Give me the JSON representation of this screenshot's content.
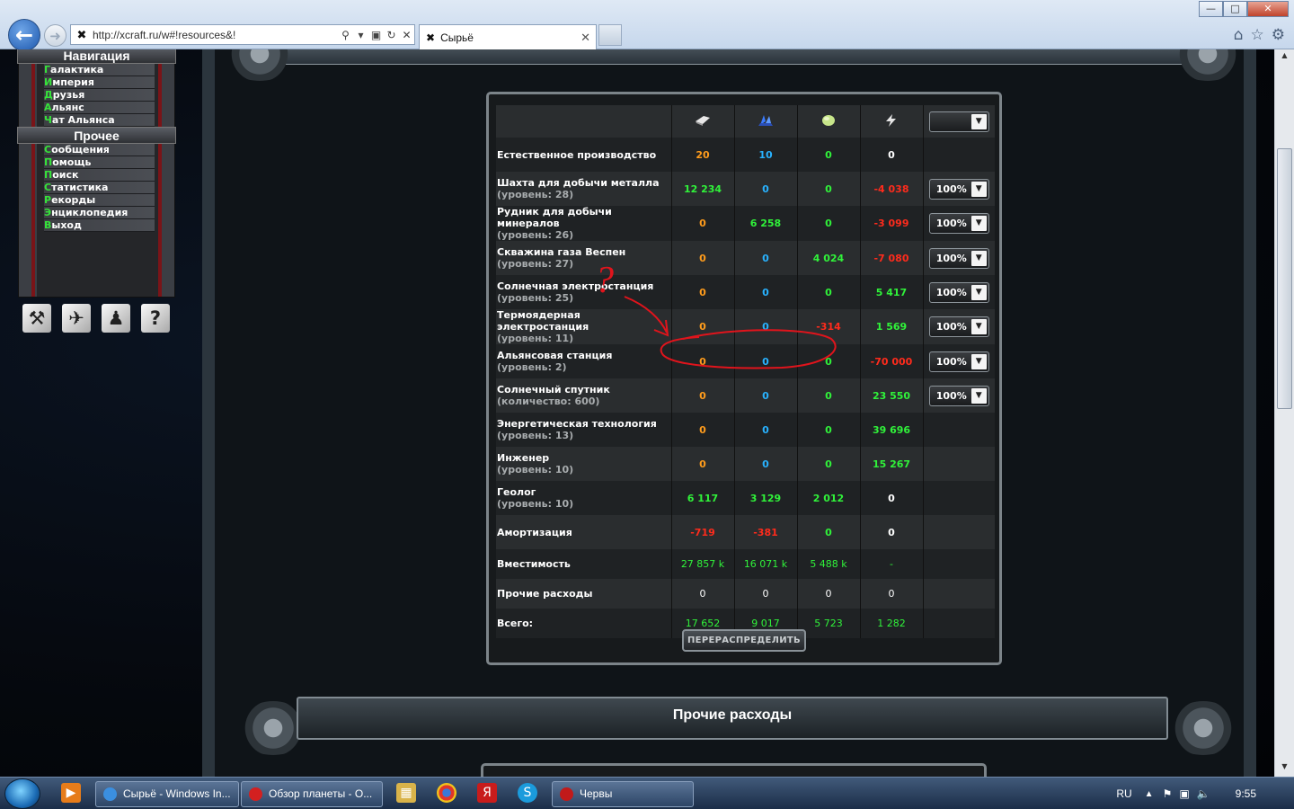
{
  "browser": {
    "url": "http://xcraft.ru/w#!resources&!",
    "tab_title": "Сырьё",
    "window_controls": [
      "minimize",
      "maximize",
      "close"
    ],
    "toolbar_icons": [
      "home-icon",
      "star-icon",
      "gear-icon"
    ]
  },
  "nav": {
    "header1": "Навигация",
    "items1": [
      "Галактика",
      "Империя",
      "Друзья",
      "Альянс",
      "Чат Альянса"
    ],
    "header2": "Прочее",
    "items2": [
      "Сообщения",
      "Помощь",
      "Поиск",
      "Статистика",
      "Рекорды",
      "Энциклопедия",
      "Выход"
    ],
    "highlight_color": "#36e23a",
    "bottom_icons": [
      "build-icon",
      "fleet-icon",
      "user-icon",
      "help-icon"
    ]
  },
  "resources": {
    "columns": [
      "metal-icon",
      "crystal-icon",
      "gas-icon",
      "energy-icon"
    ],
    "rows": [
      {
        "name": "Естественное производство",
        "sub": "",
        "values": [
          "20",
          "10",
          "0",
          "0"
        ],
        "colors": [
          "orange",
          "blue",
          "green",
          "white"
        ],
        "select": ""
      },
      {
        "name": "Шахта для добычи металла",
        "sub": "(уровень: 28)",
        "values": [
          "12 234",
          "0",
          "0",
          "-4 038"
        ],
        "colors": [
          "green",
          "blue",
          "green",
          "red"
        ],
        "select": "100%"
      },
      {
        "name": "Рудник для добычи минералов",
        "sub": "(уровень: 26)",
        "values": [
          "0",
          "6 258",
          "0",
          "-3 099"
        ],
        "colors": [
          "orange",
          "green",
          "green",
          "red"
        ],
        "select": "100%"
      },
      {
        "name": "Скважина газа Веспен",
        "sub": "(уровень: 27)",
        "values": [
          "0",
          "0",
          "4 024",
          "-7 080"
        ],
        "colors": [
          "orange",
          "blue",
          "green",
          "red"
        ],
        "select": "100%"
      },
      {
        "name": "Солнечная электростанция",
        "sub": "(уровень: 25)",
        "values": [
          "0",
          "0",
          "0",
          "5 417"
        ],
        "colors": [
          "orange",
          "blue",
          "green",
          "green"
        ],
        "select": "100%"
      },
      {
        "name": "Термоядерная электростанция",
        "sub": "(уровень: 11)",
        "values": [
          "0",
          "0",
          "-314",
          "1 569"
        ],
        "colors": [
          "orange",
          "blue",
          "red",
          "green"
        ],
        "select": "100%"
      },
      {
        "name": "Альянсовая станция",
        "sub": "(уровень: 2)",
        "values": [
          "0",
          "0",
          "0",
          "-70 000"
        ],
        "colors": [
          "orange",
          "blue",
          "green",
          "red"
        ],
        "select": "100%"
      },
      {
        "name": "Солнечный спутник",
        "sub": "(количество: 600)",
        "values": [
          "0",
          "0",
          "0",
          "23 550"
        ],
        "colors": [
          "orange",
          "blue",
          "green",
          "green"
        ],
        "select": "100%"
      },
      {
        "name": "Энергетическая технология",
        "sub": "(уровень: 13)",
        "values": [
          "0",
          "0",
          "0",
          "39 696"
        ],
        "colors": [
          "orange",
          "blue",
          "green",
          "green"
        ],
        "select": ""
      },
      {
        "name": "Инженер",
        "sub": "(уровень: 10)",
        "values": [
          "0",
          "0",
          "0",
          "15 267"
        ],
        "colors": [
          "orange",
          "blue",
          "green",
          "green"
        ],
        "select": ""
      },
      {
        "name": "Геолог",
        "sub": "(уровень: 10)",
        "values": [
          "6 117",
          "3 129",
          "2 012",
          "0"
        ],
        "colors": [
          "green",
          "green",
          "green",
          "white"
        ],
        "select": ""
      },
      {
        "name": "Амортизация",
        "sub": "",
        "values": [
          "-719",
          "-381",
          "0",
          "0"
        ],
        "colors": [
          "red",
          "red",
          "green",
          "white"
        ],
        "select": ""
      },
      {
        "name": "Вместимость",
        "sub": "",
        "values": [
          "27 857 k",
          "16 071 k",
          "5 488 k",
          "-"
        ],
        "colors": [
          "green",
          "green",
          "green",
          "green"
        ],
        "select": "",
        "short": true
      },
      {
        "name": "Прочие расходы",
        "sub": "",
        "values": [
          "0",
          "0",
          "0",
          "0"
        ],
        "colors": [
          "white",
          "white",
          "white",
          "white"
        ],
        "select": "",
        "short": true
      },
      {
        "name": "Всего:",
        "sub": "",
        "values": [
          "17 652",
          "9 017",
          "5 723",
          "1 282"
        ],
        "colors": [
          "green",
          "green",
          "green",
          "green"
        ],
        "select": "",
        "short": true
      }
    ],
    "redistribute_button": "ПЕРЕРАСПРЕДЕЛИТЬ"
  },
  "other_section_title": "Прочие расходы",
  "annotation": {
    "mark": "?",
    "color": "#e0141c"
  },
  "taskbar": {
    "tasks": [
      "Сырьё - Windows In...",
      "Обзор планеты - О...",
      "Червы"
    ],
    "lang": "RU",
    "time": "9:55"
  }
}
